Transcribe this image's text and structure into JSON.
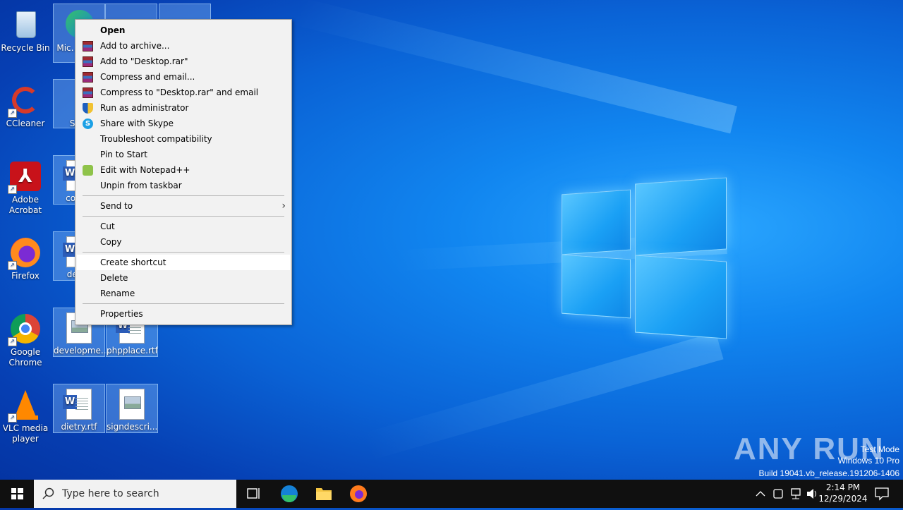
{
  "desktop": {
    "icons_left": [
      {
        "label": "Recycle Bin"
      },
      {
        "label": "CCleaner"
      },
      {
        "label": "Adobe Acrobat"
      },
      {
        "label": "Firefox"
      },
      {
        "label": "Google Chrome"
      },
      {
        "label": "VLC media player"
      }
    ],
    "icons_col2": [
      {
        "label": "Mic… Ed…"
      },
      {
        "label": "Sk…"
      },
      {
        "label": "com…"
      },
      {
        "label": "defi…"
      },
      {
        "label": "developme..."
      },
      {
        "label": "dietry.rtf"
      }
    ],
    "icons_col3": [
      {
        "label": "phpplace.rtf"
      },
      {
        "label": "signdescri..."
      }
    ]
  },
  "context_menu": {
    "items": [
      {
        "label": "Open"
      },
      {
        "label": "Add to archive..."
      },
      {
        "label": "Add to \"Desktop.rar\""
      },
      {
        "label": "Compress and email..."
      },
      {
        "label": "Compress to \"Desktop.rar\" and email"
      },
      {
        "label": "Run as administrator"
      },
      {
        "label": "Share with Skype"
      },
      {
        "label": "Troubleshoot compatibility"
      },
      {
        "label": "Pin to Start"
      },
      {
        "label": "Edit with Notepad++"
      },
      {
        "label": "Unpin from taskbar"
      },
      {
        "label": "Send to"
      },
      {
        "label": "Cut"
      },
      {
        "label": "Copy"
      },
      {
        "label": "Create shortcut"
      },
      {
        "label": "Delete"
      },
      {
        "label": "Rename"
      },
      {
        "label": "Properties"
      }
    ]
  },
  "watermark": {
    "logo": "ANY RUN",
    "line1": "Test Mode",
    "line2": "Windows 10 Pro",
    "line3": "Build 19041.vb_release.191206-1406"
  },
  "taskbar": {
    "search_placeholder": "Type here to search",
    "time": "2:14 PM",
    "date": "12/29/2024"
  },
  "colors": {
    "menu_bg": "#f2f2f2",
    "taskbar_bg": "#101010",
    "desktop_accent": "#1186f0"
  }
}
